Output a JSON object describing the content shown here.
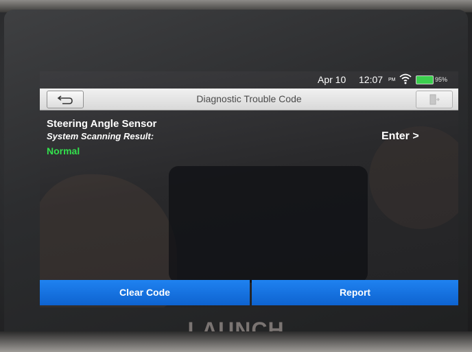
{
  "status_bar": {
    "date": "Apr 10",
    "time": "12:07",
    "ampm": "PM",
    "battery": "95%"
  },
  "header": {
    "title": "Diagnostic Trouble Code"
  },
  "content": {
    "system_name": "Steering Angle Sensor",
    "scan_label": "System Scanning Result:",
    "result": "Normal",
    "enter_label": "Enter >"
  },
  "buttons": {
    "clear_code": "Clear Code",
    "report": "Report"
  },
  "device": {
    "brand": "LAUNCH"
  },
  "colors": {
    "result_green": "#33e04d",
    "button_blue": "#1575e6",
    "header_bg": "#e6e6e6"
  },
  "icons": {
    "back": "back-arrow-icon",
    "exit": "exit-door-icon",
    "wifi": "wifi-icon",
    "battery": "battery-icon"
  }
}
